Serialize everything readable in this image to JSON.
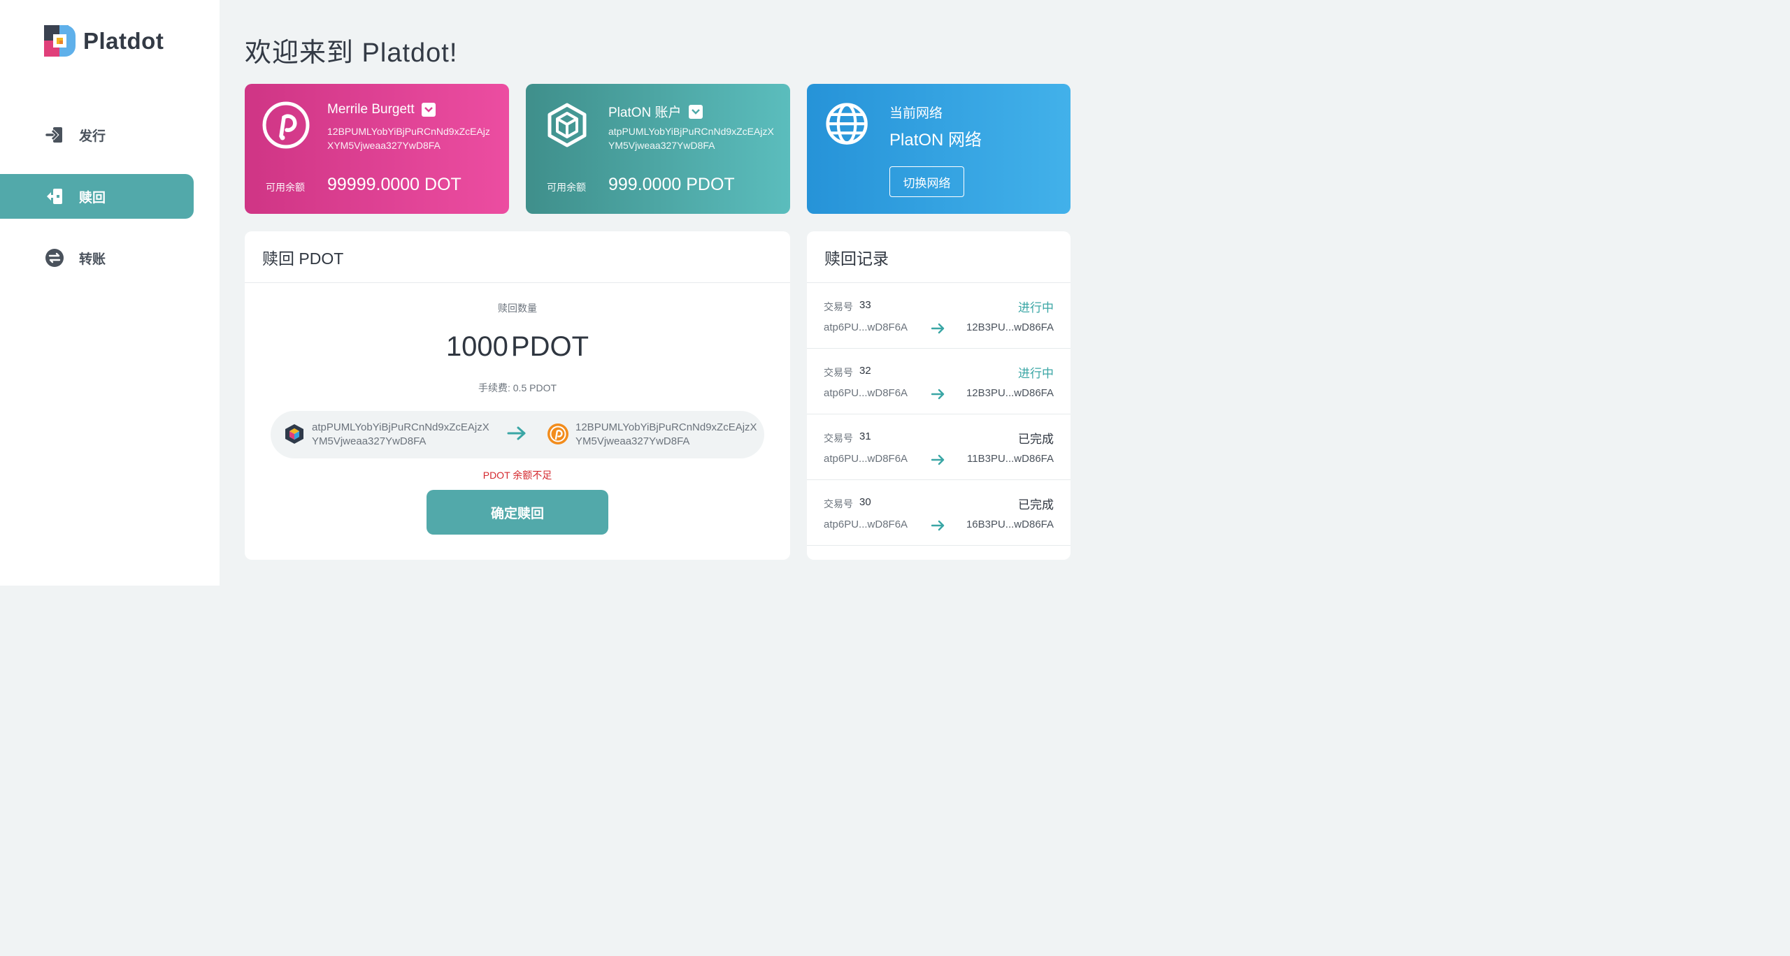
{
  "app": {
    "name": "Platdot"
  },
  "sidebar": {
    "items": [
      {
        "label": "发行",
        "icon": "sign-in-icon"
      },
      {
        "label": "赎回",
        "icon": "sign-out-icon",
        "active": true
      },
      {
        "label": "转账",
        "icon": "transfer-icon"
      }
    ]
  },
  "header": {
    "title": "欢迎来到 Platdot!"
  },
  "cards": {
    "polkadot": {
      "name": "Merrile Burgett",
      "address": "12BPUMLYobYiBjPuRCnNd9xZcEAjzXYM5Vjweaa327YwD8FA",
      "balance_label": "可用余额",
      "balance": "99999.0000 DOT",
      "color": "#e03f94"
    },
    "platon": {
      "name": "PlatON 账户",
      "address": "atpPUMLYobYiBjPuRCnNd9xZcEAjzXYM5Vjweaa327YwD8FA",
      "balance_label": "可用余额",
      "balance": "999.0000 PDOT",
      "color": "#4ea9a8"
    },
    "network": {
      "label": "当前网络",
      "value": "PlatON 网络",
      "button": "切换网络",
      "color": "#33a2e2"
    }
  },
  "redeem": {
    "title": "赎回 PDOT",
    "amount_label": "赎回数量",
    "amount": "1000",
    "unit": "PDOT",
    "fee": "手续费: 0.5 PDOT",
    "from_address": "atpPUMLYobYiBjPuRCnNd9xZcEAjzXYM5Vjweaa327YwD8FA",
    "to_address": "12BPUMLYobYiBjPuRCnNd9xZcEAjzXYM5Vjweaa327YwD8FA",
    "warning": "PDOT 余额不足",
    "confirm": "确定赎回",
    "warning_color": "#d4282e",
    "accent": "#52a9aa"
  },
  "records": {
    "title": "赎回记录",
    "tx_label": "交易号",
    "items": [
      {
        "tx": "33",
        "status": "进行中",
        "state": "pending",
        "from": "atp6PU...wD8F6A",
        "to": "12B3PU...wD86FA"
      },
      {
        "tx": "32",
        "status": "进行中",
        "state": "pending",
        "from": "atp6PU...wD8F6A",
        "to": "12B3PU...wD86FA"
      },
      {
        "tx": "31",
        "status": "已完成",
        "state": "done",
        "from": "atp6PU...wD8F6A",
        "to": "11B3PU...wD86FA"
      },
      {
        "tx": "30",
        "status": "已完成",
        "state": "done",
        "from": "atp6PU...wD8F6A",
        "to": "16B3PU...wD86FA"
      }
    ]
  }
}
